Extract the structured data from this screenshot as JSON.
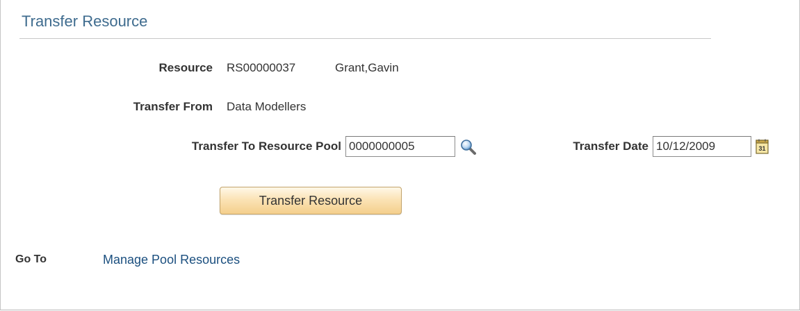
{
  "page": {
    "title": "Transfer Resource"
  },
  "resource": {
    "label": "Resource",
    "id": "RS00000037",
    "name": "Grant,Gavin"
  },
  "transfer_from": {
    "label": "Transfer From",
    "value": "Data Modellers"
  },
  "transfer_to": {
    "label": "Transfer To Resource Pool",
    "value": "0000000005",
    "lookup_icon": "magnifier-icon"
  },
  "transfer_date": {
    "label": "Transfer Date",
    "value": "10/12/2009",
    "calendar_icon": "calendar-icon",
    "calendar_glyph": "31"
  },
  "actions": {
    "transfer_button_label": "Transfer Resource"
  },
  "goto": {
    "label": "Go To",
    "link": "Manage Pool Resources"
  },
  "colors": {
    "title": "#3e6b8e",
    "link": "#1b4f7f",
    "button_top": "#fff8e8",
    "button_bottom": "#f4cf8c"
  }
}
